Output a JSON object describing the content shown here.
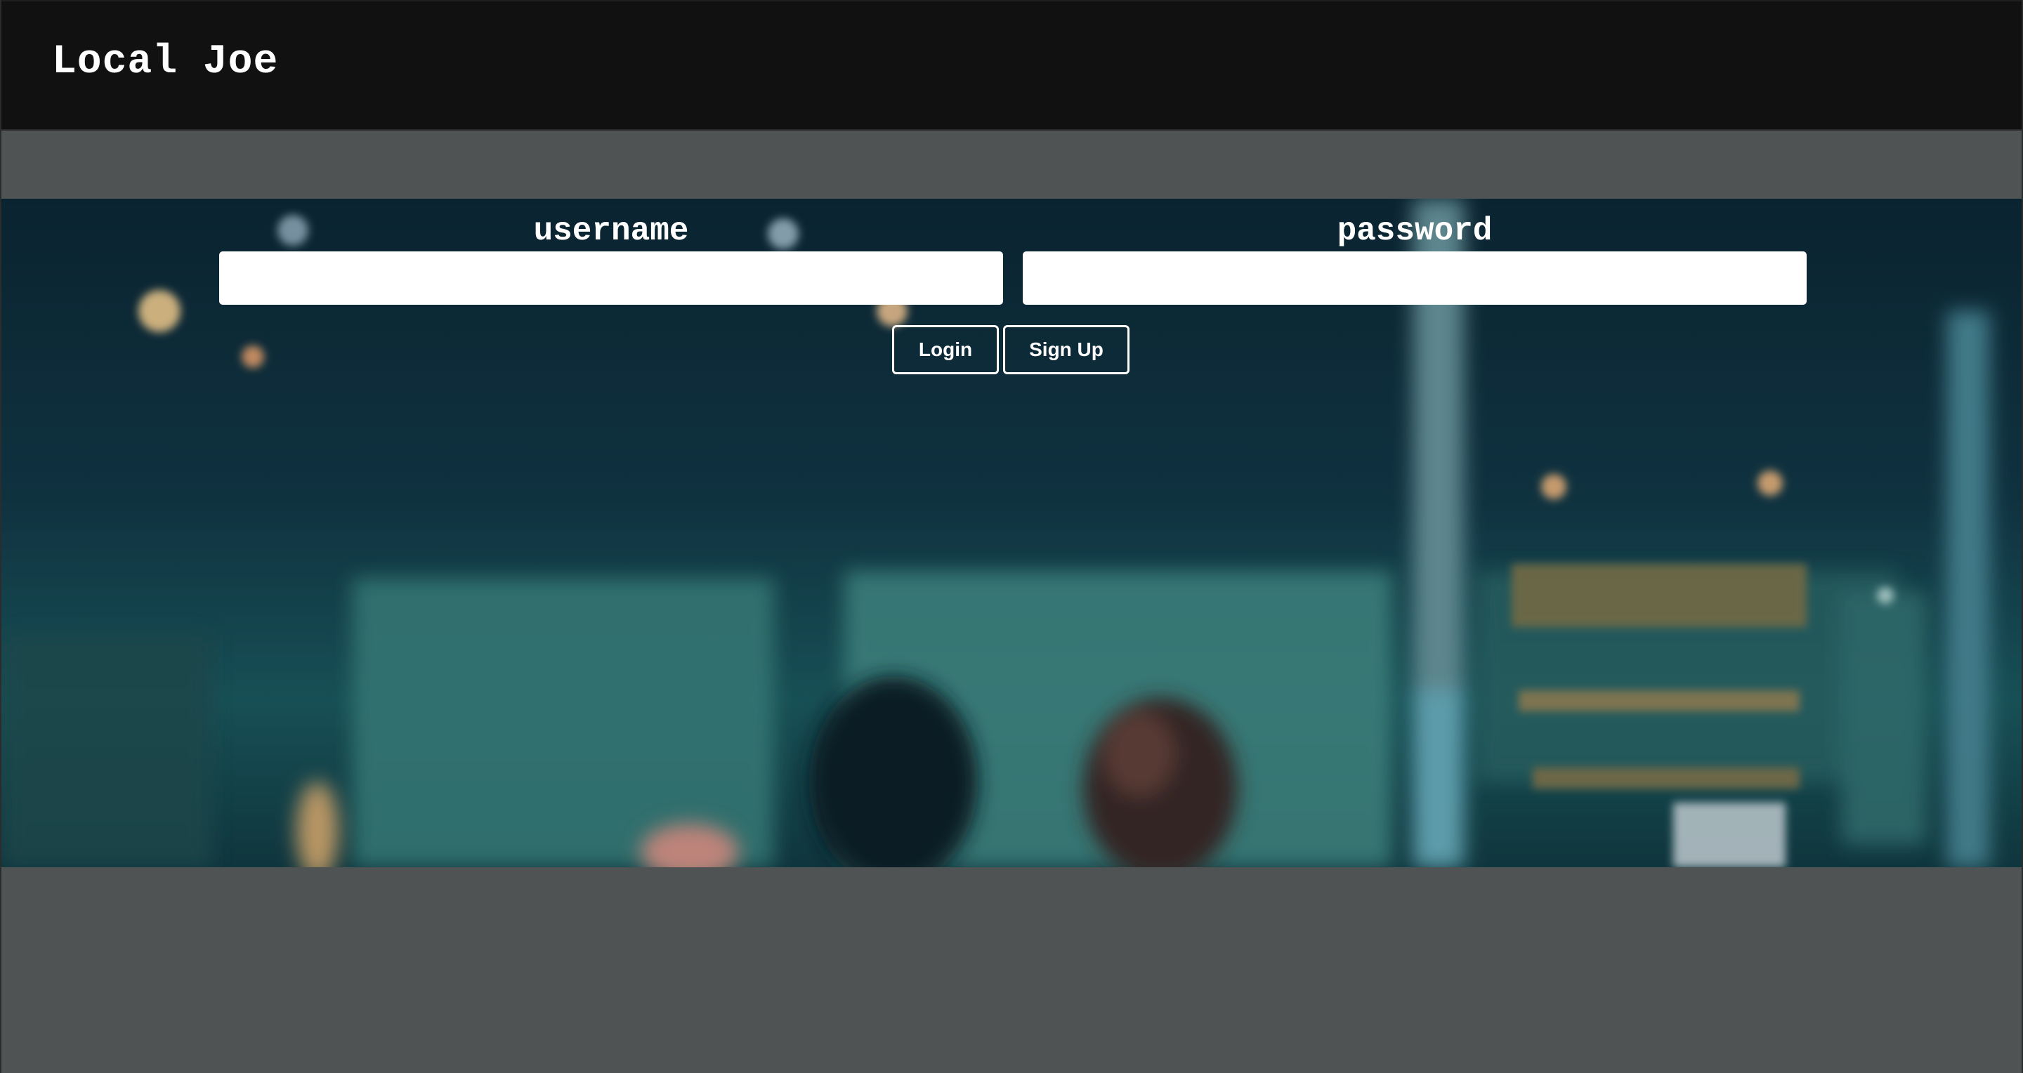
{
  "header": {
    "brand": "Local Joe"
  },
  "login_form": {
    "username_label": "username",
    "username_value": "",
    "password_label": "password",
    "password_value": "",
    "login_button": "Login",
    "signup_button": "Sign Up"
  },
  "colors": {
    "header_bg": "#111111",
    "page_bg": "#4f5354",
    "hero_tint": "#0f2c38",
    "button_border": "#ffffff"
  }
}
